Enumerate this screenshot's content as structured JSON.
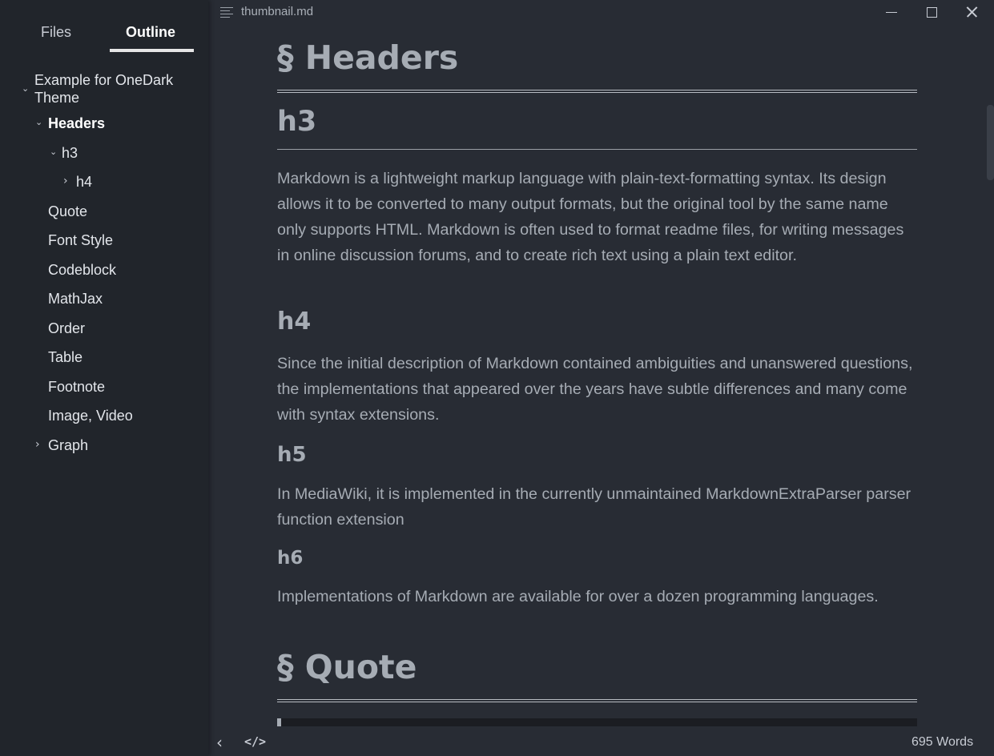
{
  "window": {
    "filename": "thumbnail.md",
    "minimize_icon": "minimize-icon",
    "maximize_icon": "maximize-icon",
    "close_icon": "close-icon"
  },
  "sidebar": {
    "tabs": [
      {
        "label": "Files",
        "active": false
      },
      {
        "label": "Outline",
        "active": true
      }
    ],
    "outline": [
      {
        "label": "Example for OneDark",
        "label2": "Theme",
        "level": 0,
        "caret": "expanded"
      },
      {
        "label": "Headers",
        "level": 1,
        "caret": "expanded",
        "active": true
      },
      {
        "label": "h3",
        "level": 2,
        "caret": "expanded"
      },
      {
        "label": "h4",
        "level": 3,
        "caret": "collapsed"
      },
      {
        "label": "Quote",
        "level": 1
      },
      {
        "label": "Font Style",
        "level": 1
      },
      {
        "label": "Codeblock",
        "level": 1
      },
      {
        "label": "MathJax",
        "level": 1
      },
      {
        "label": "Order",
        "level": 1
      },
      {
        "label": "Table",
        "level": 1
      },
      {
        "label": "Footnote",
        "level": 1
      },
      {
        "label": "Image, Video",
        "level": 1
      },
      {
        "label": "Graph",
        "level": 1,
        "caret": "collapsed"
      }
    ]
  },
  "content": {
    "h2_headers": "§ Headers",
    "h3": "h3",
    "p1": "Markdown is a lightweight markup language with plain-text-formatting syntax. Its design allows it to be converted to many output formats, but the original tool by the same name only supports HTML. Markdown is often used to format readme files, for writing messages in online discussion forums, and to create rich text using a plain text editor.",
    "h4": "h4",
    "p2": "Since the initial description of Markdown contained ambiguities and unanswered questions, the implementations that appeared over the years have subtle differences and many come with syntax extensions.",
    "h5": "h5",
    "p3": "In MediaWiki, it is implemented in the currently unmaintained MarkdownExtraParser parser function extension",
    "h6": "h6",
    "p4": "Implementations of Markdown are available for over a dozen programming languages.",
    "h2_quote": "§ Quote"
  },
  "footer": {
    "back_icon": "chevron-left-icon",
    "source_icon": "code-icon",
    "word_count": "695 Words"
  },
  "colors": {
    "background": "#282c34",
    "sidebar": "#21252b",
    "text": "#a6acb4"
  }
}
